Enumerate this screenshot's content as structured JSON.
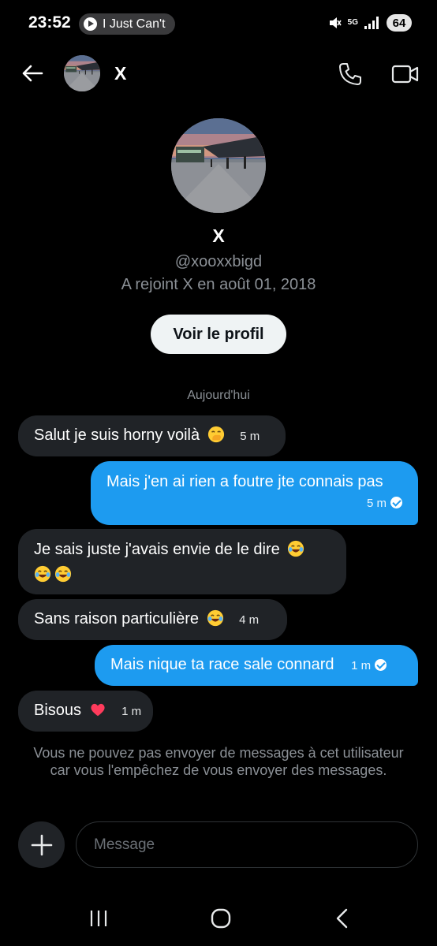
{
  "status_bar": {
    "time": "23:52",
    "media_title": "I Just Can't",
    "network": "5G",
    "battery": "64"
  },
  "header": {
    "name": "X",
    "icons": [
      "back-arrow-icon",
      "phone-icon",
      "video-icon"
    ]
  },
  "profile": {
    "name": "X",
    "handle": "@xooxxbigd",
    "joined": "A rejoint X en août 01, 2018",
    "view_profile_label": "Voir le profil"
  },
  "date_separator": "Aujourd'hui",
  "messages": [
    {
      "direction": "in",
      "text": "Salut je suis horny voilà",
      "emoji": "hand-over-mouth",
      "time": "5 m"
    },
    {
      "direction": "out",
      "text": "Mais j'en ai rien a foutre jte connais pas",
      "time": "5 m",
      "read": true
    },
    {
      "direction": "in",
      "text": "Je sais juste j'avais envie de le dire",
      "emoji": "tears-of-joy x3",
      "time": ""
    },
    {
      "direction": "in",
      "text": "Sans raison particulière",
      "emoji": "tears-of-joy",
      "time": "4 m"
    },
    {
      "direction": "out",
      "text": "Mais nique ta race sale connard",
      "time": "1 m",
      "read": true
    },
    {
      "direction": "in",
      "text": "Bisous",
      "emoji": "red-heart",
      "time": "1 m"
    }
  ],
  "notice": "Vous ne pouvez pas envoyer de messages à cet utilisateur car vous l'empêchez de vous envoyer des messages.",
  "composer": {
    "placeholder": "Message"
  },
  "colors": {
    "background": "#000000",
    "incoming_bubble": "#202327",
    "outgoing_bubble": "#1d9bf0",
    "secondary_text": "#8b9096"
  }
}
